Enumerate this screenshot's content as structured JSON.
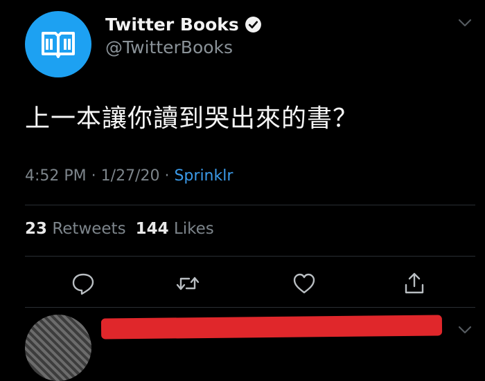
{
  "tweet": {
    "display_name": "Twitter Books",
    "handle": "@TwitterBooks",
    "text": "上一本讓你讀到哭出來的書？",
    "time": "4:52 PM",
    "date": "1/27/20",
    "separator": "·",
    "source": "Sprinklr",
    "retweets_count": "23",
    "retweets_label": "Retweets",
    "likes_count": "144",
    "likes_label": "Likes"
  },
  "icons": {
    "avatar": "open-book-icon",
    "verified": "verified-badge-icon",
    "menu": "chevron-down-icon",
    "reply": "reply-icon",
    "retweet": "retweet-icon",
    "like": "heart-icon",
    "share": "share-icon"
  },
  "colors": {
    "background": "#000000",
    "avatar_blue": "#1da1f2",
    "link_blue": "#3b9ae8",
    "muted_text": "#7d858b",
    "redaction_red": "#e0272b"
  }
}
